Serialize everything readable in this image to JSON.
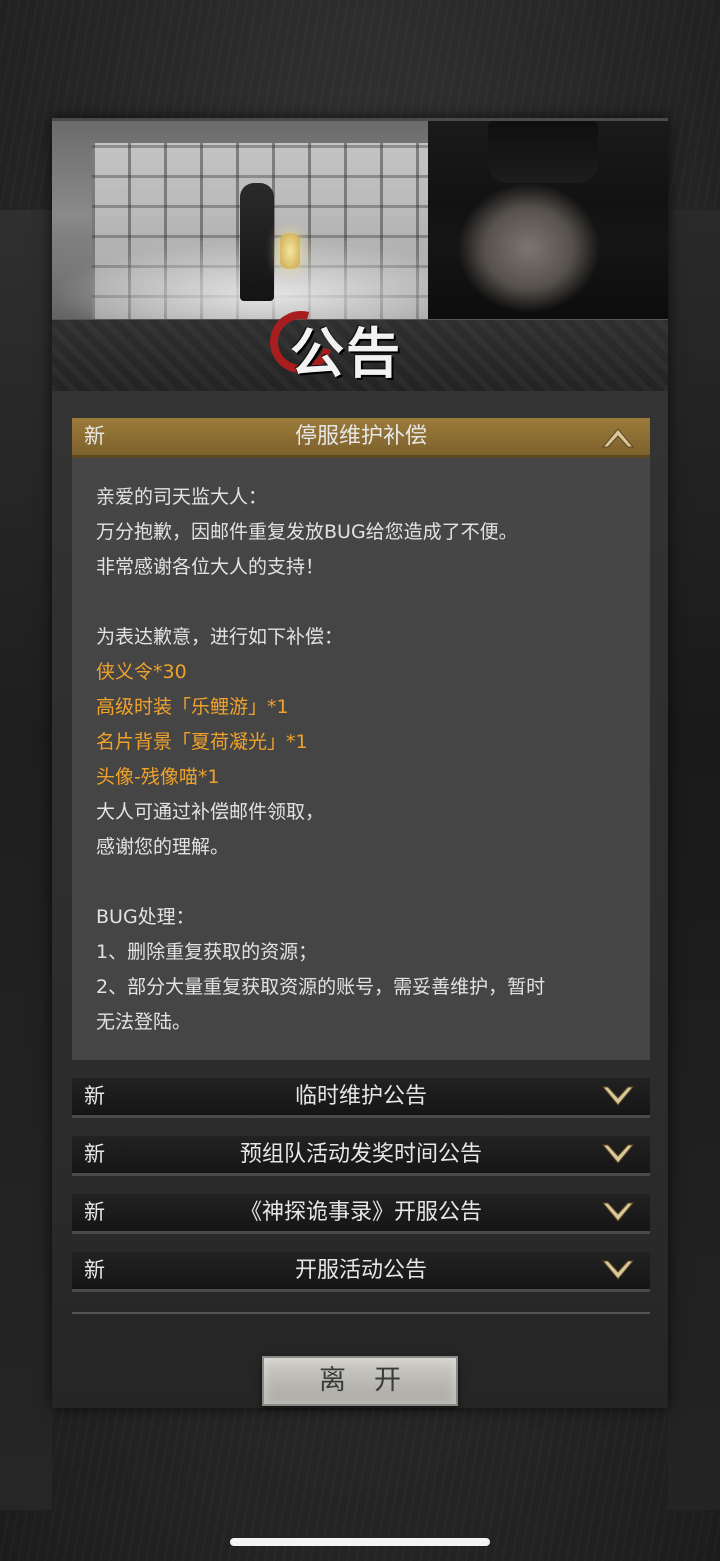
{
  "banner": {
    "title": "公告"
  },
  "announcements": [
    {
      "badge": "新",
      "title": "停服维护补偿",
      "expanded": true,
      "lines": [
        "亲爱的司天监大人：",
        "万分抱歉，因邮件重复发放BUG给您造成了不便。",
        "非常感谢各位大人的支持！",
        "",
        "为表达歉意，进行如下补偿：",
        "侠义令*30",
        "高级时装「乐鲤游」*1",
        "名片背景「夏荷凝光」*1",
        "头像-残像喵*1",
        "大人可通过补偿邮件领取，",
        "感谢您的理解。",
        "",
        "BUG处理：",
        "1、删除重复获取的资源；",
        "2、部分大量重复获取资源的账号，需妥善维护，暂时",
        "无法登陆。"
      ],
      "highlight_color": "#f0a22b"
    },
    {
      "badge": "新",
      "title": "临时维护公告",
      "expanded": false
    },
    {
      "badge": "新",
      "title": "预组队活动发奖时间公告",
      "expanded": false
    },
    {
      "badge": "新",
      "title": "《神探诡事录》开服公告",
      "expanded": false
    },
    {
      "badge": "新",
      "title": "开服活动公告",
      "expanded": false
    }
  ],
  "leave_button": {
    "label": "离开"
  },
  "colors": {
    "accent_gold": "#8c6d33",
    "highlight": "#f0a22b"
  },
  "icons": {
    "collapse": "chevron-up-icon",
    "expand": "chevron-down-icon"
  }
}
